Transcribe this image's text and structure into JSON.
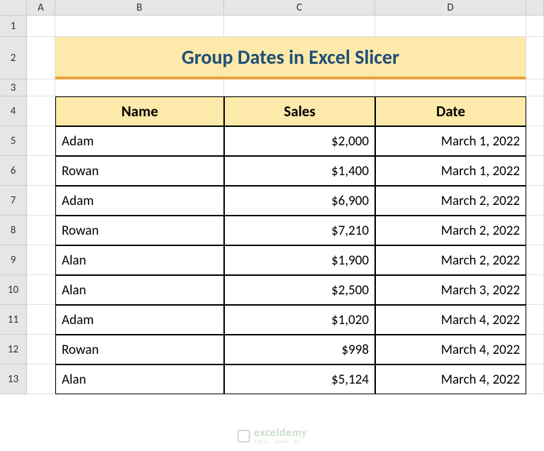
{
  "columns": [
    "A",
    "B",
    "C",
    "D"
  ],
  "rows": [
    "1",
    "2",
    "3",
    "4",
    "5",
    "6",
    "7",
    "8",
    "9",
    "10",
    "11",
    "12",
    "13"
  ],
  "title": "Group Dates in Excel Slicer",
  "headers": {
    "name": "Name",
    "sales": "Sales",
    "date": "Date"
  },
  "data": [
    {
      "name": "Adam",
      "sales": "$2,000",
      "date": "March 1, 2022"
    },
    {
      "name": "Rowan",
      "sales": "$1,400",
      "date": "March 1, 2022"
    },
    {
      "name": "Adam",
      "sales": "$6,900",
      "date": "March 2, 2022"
    },
    {
      "name": "Rowan",
      "sales": "$7,210",
      "date": "March 2, 2022"
    },
    {
      "name": "Alan",
      "sales": "$1,900",
      "date": "March 2, 2022"
    },
    {
      "name": "Alan",
      "sales": "$2,500",
      "date": "March 3, 2022"
    },
    {
      "name": "Adam",
      "sales": "$1,020",
      "date": "March 4, 2022"
    },
    {
      "name": "Rowan",
      "sales": "$998",
      "date": "March 4, 2022"
    },
    {
      "name": "Alan",
      "sales": "$5,124",
      "date": "March 4, 2022"
    }
  ],
  "watermark": {
    "name": "exceldemy",
    "tag": "EXCEL · DATA · BI"
  },
  "chart_data": {
    "type": "table",
    "title": "Group Dates in Excel Slicer",
    "columns": [
      "Name",
      "Sales",
      "Date"
    ],
    "rows": [
      [
        "Adam",
        2000,
        "2022-03-01"
      ],
      [
        "Rowan",
        1400,
        "2022-03-01"
      ],
      [
        "Adam",
        6900,
        "2022-03-02"
      ],
      [
        "Rowan",
        7210,
        "2022-03-02"
      ],
      [
        "Alan",
        1900,
        "2022-03-02"
      ],
      [
        "Alan",
        2500,
        "2022-03-03"
      ],
      [
        "Adam",
        1020,
        "2022-03-04"
      ],
      [
        "Rowan",
        998,
        "2022-03-04"
      ],
      [
        "Alan",
        5124,
        "2022-03-04"
      ]
    ]
  }
}
